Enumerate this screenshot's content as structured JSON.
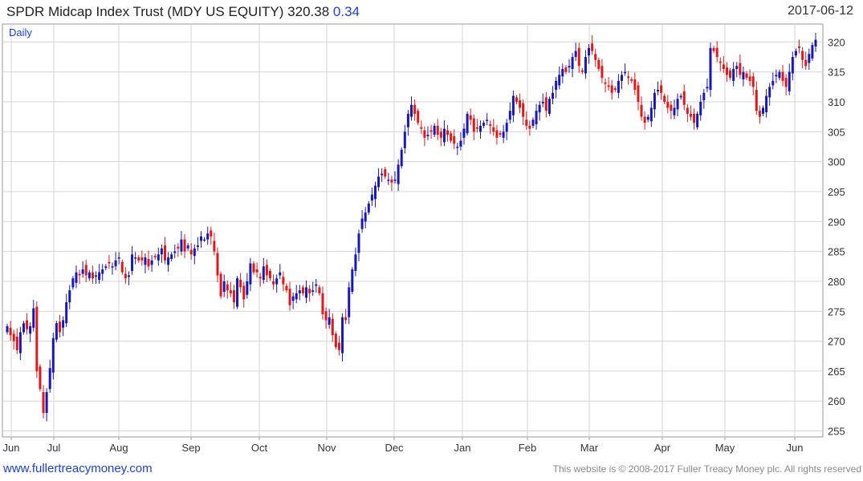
{
  "header": {
    "title": "SPDR Midcap Index Trust (MDY US EQUITY) 320.38",
    "change": "0.34",
    "date": "2017-06-12"
  },
  "footer": {
    "left": "www.fullertreacymoney.com",
    "right": "This website is © 2008-2017 Fuller Treacy Money plc. All rights reserved"
  },
  "colors": {
    "up": "#1818b8",
    "down": "#e01818",
    "grid": "#d4d4d4",
    "change": "#1a3fd6"
  },
  "chart_data": {
    "type": "candlestick",
    "title": "SPDR Midcap Index Trust (MDY US EQUITY) 320.38 0.34",
    "period_label": "Daily",
    "ylim": [
      254,
      323
    ],
    "y_ticks": [
      255,
      260,
      265,
      270,
      275,
      280,
      285,
      290,
      295,
      300,
      305,
      310,
      315,
      320
    ],
    "y_axis_position": "right",
    "x_ticks": [
      "Jun",
      "Jul",
      "Aug",
      "Sep",
      "Oct",
      "Nov",
      "Dec",
      "Jan",
      "Feb",
      "Mar",
      "Apr",
      "May",
      "Jun"
    ],
    "grid": true,
    "close_series": [
      272.5,
      271.0,
      270.0,
      268.5,
      271.5,
      273.0,
      272.0,
      272.5,
      275.5,
      265.0,
      262.0,
      258.0,
      261.5,
      265.5,
      270.5,
      273.0,
      271.5,
      273.5,
      276.5,
      278.5,
      280.5,
      281.5,
      281.0,
      282.0,
      281.0,
      281.5,
      280.5,
      281.0,
      281.5,
      282.0,
      282.5,
      283.0,
      282.5,
      283.5,
      284.0,
      281.5,
      280.5,
      281.0,
      284.5,
      284.0,
      283.5,
      283.5,
      284.0,
      282.5,
      283.5,
      284.0,
      284.5,
      285.5,
      283.5,
      284.0,
      284.5,
      285.0,
      285.5,
      287.0,
      285.0,
      286.0,
      284.5,
      285.5,
      286.0,
      287.5,
      287.0,
      288.0,
      287.5,
      285.0,
      281.0,
      277.5,
      280.0,
      278.5,
      278.0,
      276.5,
      280.5,
      279.0,
      277.0,
      280.0,
      283.0,
      281.5,
      281.5,
      280.5,
      282.5,
      281.0,
      280.5,
      279.5,
      280.5,
      281.5,
      279.5,
      278.5,
      276.0,
      277.5,
      278.0,
      278.5,
      278.0,
      279.0,
      278.0,
      278.5,
      279.5,
      278.0,
      274.5,
      273.5,
      274.0,
      271.0,
      269.0,
      268.5,
      274.0,
      273.5,
      279.0,
      282.0,
      284.5,
      288.0,
      290.5,
      291.5,
      293.0,
      294.5,
      296.0,
      297.5,
      298.0,
      297.5,
      297.0,
      296.5,
      297.0,
      299.5,
      302.0,
      305.0,
      308.0,
      309.5,
      308.0,
      306.5,
      305.5,
      304.0,
      304.5,
      305.0,
      306.0,
      304.5,
      304.0,
      305.5,
      304.5,
      303.5,
      303.0,
      302.5,
      303.5,
      305.5,
      308.0,
      307.0,
      305.0,
      305.5,
      306.0,
      306.5,
      307.0,
      306.0,
      305.0,
      304.0,
      304.5,
      305.0,
      306.5,
      308.5,
      311.0,
      310.0,
      309.0,
      307.5,
      306.0,
      305.5,
      307.0,
      308.5,
      309.5,
      310.0,
      308.5,
      310.5,
      311.5,
      313.5,
      314.5,
      315.5,
      315.0,
      316.0,
      317.5,
      318.5,
      316.0,
      315.0,
      317.5,
      319.0,
      318.5,
      317.0,
      315.5,
      314.0,
      313.0,
      312.5,
      311.5,
      312.0,
      313.5,
      314.5,
      315.0,
      314.0,
      313.5,
      312.0,
      310.0,
      307.5,
      306.5,
      307.5,
      309.0,
      311.5,
      312.0,
      311.5,
      310.0,
      309.0,
      308.5,
      309.0,
      310.5,
      311.0,
      309.5,
      308.0,
      307.5,
      306.5,
      308.0,
      310.0,
      311.5,
      312.5,
      319.0,
      318.5,
      317.5,
      316.5,
      315.5,
      314.5,
      314.0,
      315.5,
      316.0,
      314.5,
      315.0,
      314.0,
      313.5,
      312.5,
      308.5,
      307.5,
      309.0,
      311.0,
      312.5,
      313.5,
      314.5,
      315.0,
      313.5,
      312.5,
      315.0,
      317.5,
      318.5,
      319.0,
      317.0,
      316.0,
      318.0,
      319.5,
      320.38
    ]
  }
}
